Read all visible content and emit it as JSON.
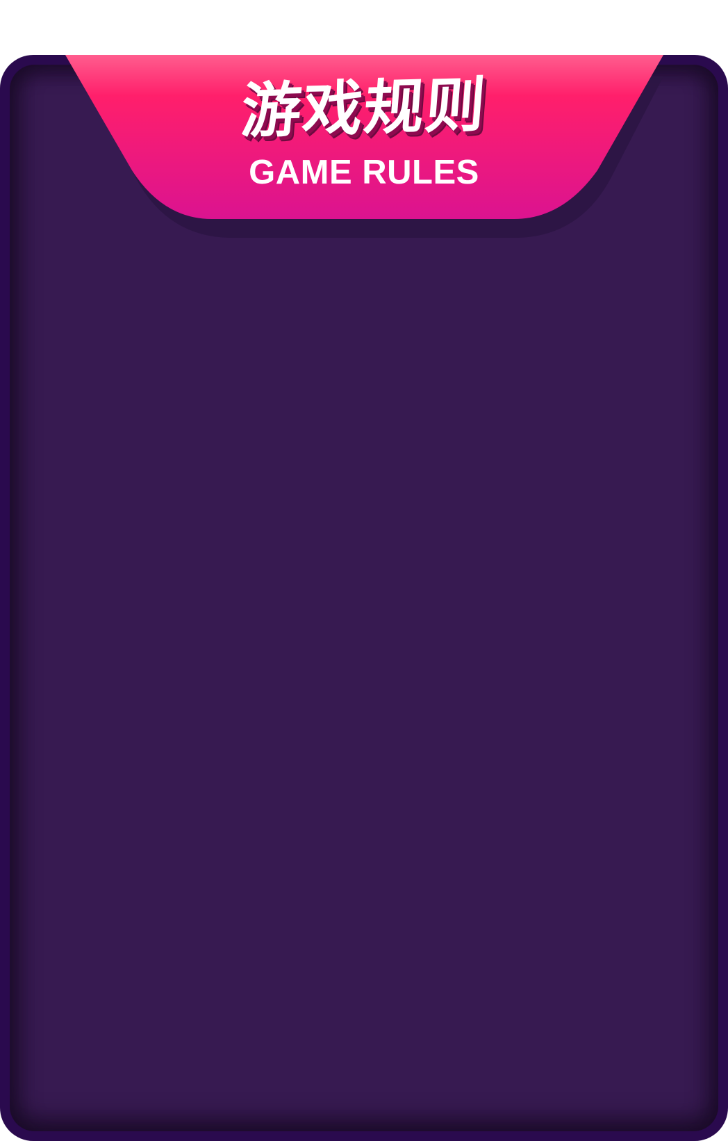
{
  "header": {
    "title_cn": "游戏规则",
    "title_en": "GAME RULES"
  },
  "colors": {
    "panel_border": "#2a0a4e",
    "panel_body": "#371a51",
    "banner_top": "#ff3d7f",
    "banner_bottom": "#d6138f",
    "banner_text": "#ffffff"
  },
  "icons": {
    "banner": "ribbon-banner"
  }
}
